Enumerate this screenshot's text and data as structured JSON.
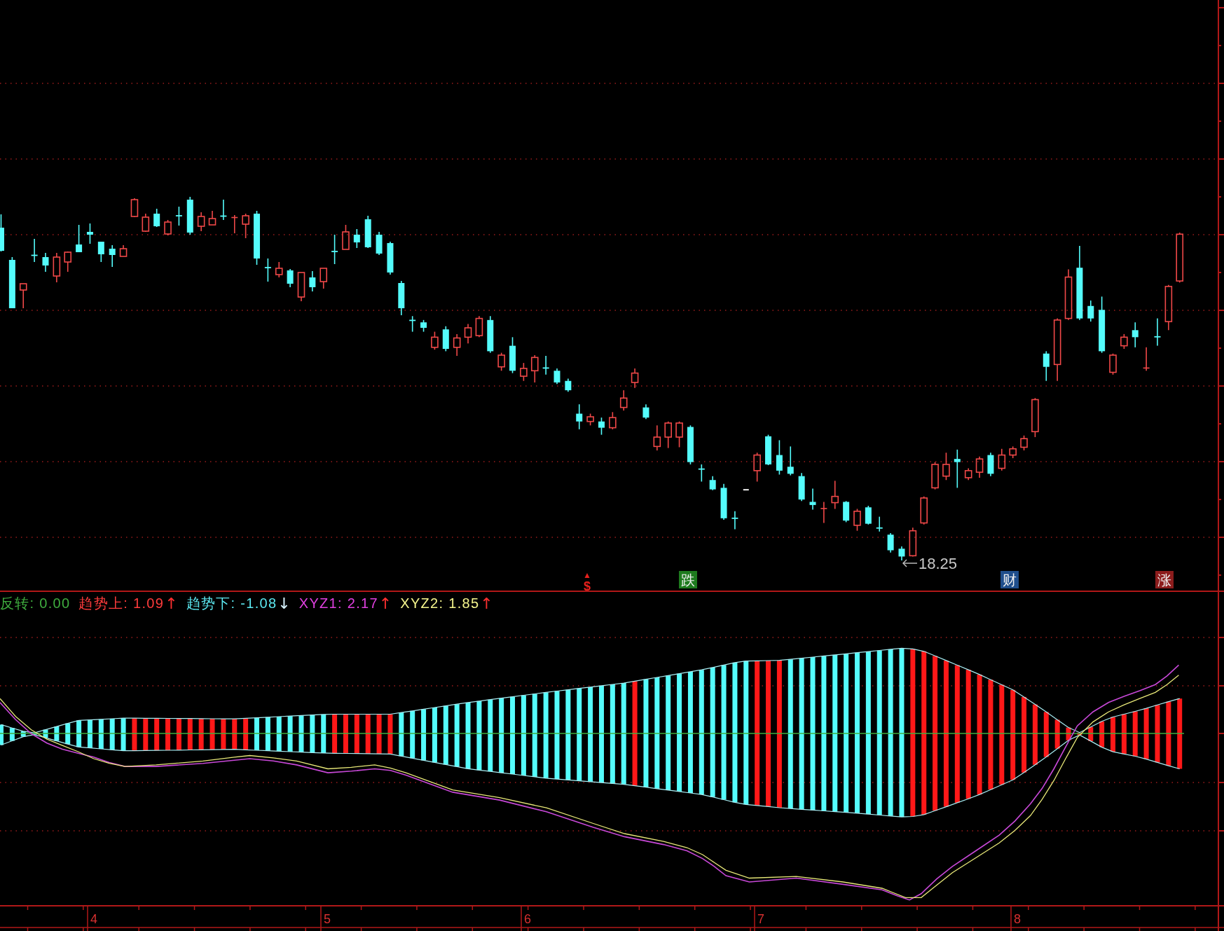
{
  "price_chart": {
    "low_price_label": "18.25",
    "signals": [
      {
        "kind": "symbol",
        "text": "$",
        "color": "#e8201c"
      },
      {
        "kind": "tag",
        "text": "跌",
        "color": "#1e7b1e"
      },
      {
        "kind": "tag",
        "text": "财",
        "color": "#1f4e8c"
      },
      {
        "kind": "tag",
        "text": "涨",
        "color": "#8c1c1c"
      }
    ]
  },
  "indicator": {
    "legend": [
      {
        "text": "反转: 0.00",
        "color": "#3fae3f"
      },
      {
        "text": "趋势上: 1.09",
        "color": "#ff3c3c",
        "arrow": {
          "text": "↑",
          "color": "#ff3030"
        }
      },
      {
        "text": "趋势下: -1.08",
        "color": "#5ce8f0",
        "arrow": {
          "text": "↓",
          "color": "#d8f4ff"
        }
      },
      {
        "text": "XYZ1: 2.17",
        "color": "#e040e0",
        "arrow": {
          "text": "↑",
          "color": "#ff3030"
        }
      },
      {
        "text": "XYZ2: 1.85",
        "color": "#f4f48c",
        "arrow": {
          "text": "↑",
          "color": "#ff3030"
        }
      }
    ]
  },
  "time_axis": {
    "labels": [
      "4",
      "5",
      "6",
      "7",
      "8"
    ]
  }
}
